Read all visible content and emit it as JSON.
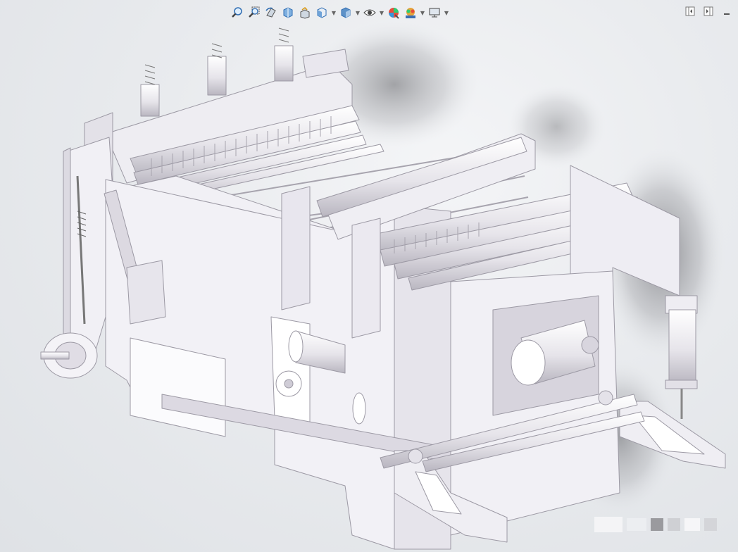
{
  "app": {
    "name": "CAD 3D viewport"
  },
  "heads_up_toolbar": {
    "buttons": [
      {
        "id": "zoom-to-fit",
        "icon": "magnifier-icon"
      },
      {
        "id": "zoom-to-area",
        "icon": "zoom-area-icon"
      },
      {
        "id": "previous-view",
        "icon": "previous-view-icon"
      },
      {
        "id": "section-view",
        "icon": "section-view-icon"
      },
      {
        "id": "dynamic-annotation",
        "icon": "annotation-view-icon"
      },
      {
        "id": "view-orientation",
        "icon": "cube-view-icon",
        "dropdown": true
      },
      {
        "id": "display-style",
        "icon": "display-style-cube-icon",
        "dropdown": true
      },
      {
        "id": "hide-show-items",
        "icon": "eye-icon",
        "dropdown": true
      },
      {
        "id": "edit-appearance",
        "icon": "appearance-sphere-icon"
      },
      {
        "id": "apply-scene",
        "icon": "scene-icon",
        "dropdown": true
      },
      {
        "id": "view-settings",
        "icon": "monitor-icon",
        "dropdown": true
      }
    ]
  },
  "window_controls": [
    "restore-left-icon",
    "restore-right-icon",
    "minimize-icon"
  ],
  "colors": {
    "model_body": "#f3f2f6",
    "model_edge": "#b8b5bf",
    "model_shadow": "#cfccd6",
    "toolbar_blue": "#2f6db3"
  }
}
